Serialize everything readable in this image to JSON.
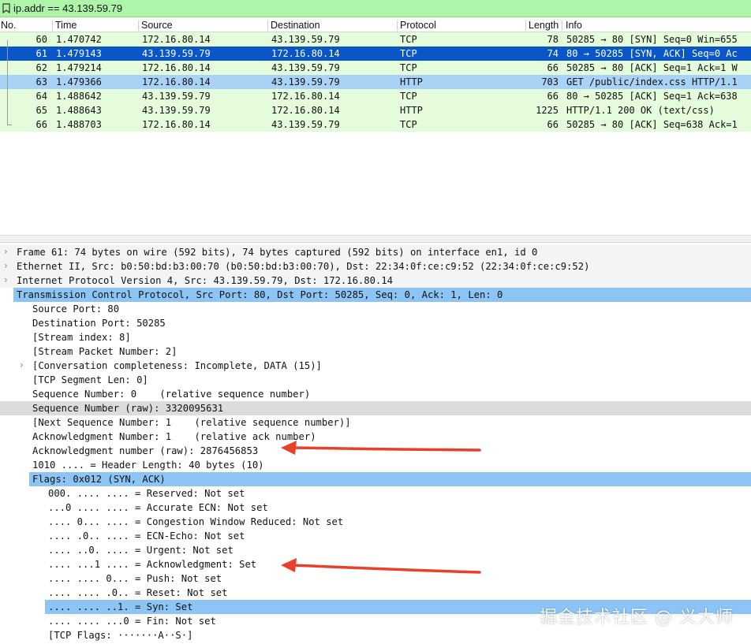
{
  "filter": {
    "value": "ip.addr == 43.139.59.79",
    "icon": "bookmark-icon"
  },
  "packet_list": {
    "columns": [
      "No.",
      "Time",
      "Source",
      "Destination",
      "Protocol",
      "Length",
      "Info"
    ],
    "rows": [
      {
        "no": "60",
        "time": "1.470742",
        "src": "172.16.80.14",
        "dst": "43.139.59.79",
        "proto": "TCP",
        "len": "78",
        "info": "50285 → 80 [SYN] Seq=0 Win=655",
        "bg": "#e4fbdc",
        "fg": "#111111"
      },
      {
        "no": "61",
        "time": "1.479143",
        "src": "43.139.59.79",
        "dst": "172.16.80.14",
        "proto": "TCP",
        "len": "74",
        "info": "80 → 50285 [SYN, ACK] Seq=0 Ac",
        "bg": "#0a55c8",
        "fg": "#ffffff"
      },
      {
        "no": "62",
        "time": "1.479214",
        "src": "172.16.80.14",
        "dst": "43.139.59.79",
        "proto": "TCP",
        "len": "66",
        "info": "50285 → 80 [ACK] Seq=1 Ack=1 W",
        "bg": "#e4fbdc",
        "fg": "#111111"
      },
      {
        "no": "63",
        "time": "1.479366",
        "src": "172.16.80.14",
        "dst": "43.139.59.79",
        "proto": "HTTP",
        "len": "703",
        "info": "GET /public/index.css HTTP/1.1",
        "bg": "#a8d3f7",
        "fg": "#111111"
      },
      {
        "no": "64",
        "time": "1.488642",
        "src": "43.139.59.79",
        "dst": "172.16.80.14",
        "proto": "TCP",
        "len": "66",
        "info": "80 → 50285 [ACK] Seq=1 Ack=638",
        "bg": "#e4fbdc",
        "fg": "#111111"
      },
      {
        "no": "65",
        "time": "1.488643",
        "src": "43.139.59.79",
        "dst": "172.16.80.14",
        "proto": "HTTP",
        "len": "1225",
        "info": "HTTP/1.1 200 OK  (text/css)",
        "bg": "#e4fbdc",
        "fg": "#111111"
      },
      {
        "no": "66",
        "time": "1.488703",
        "src": "172.16.80.14",
        "dst": "43.139.59.79",
        "proto": "TCP",
        "len": "66",
        "info": "50285 → 80 [ACK] Seq=638 Ack=1",
        "bg": "#e4fbdc",
        "fg": "#111111"
      }
    ]
  },
  "details": [
    {
      "text": "Frame 61: 74 bytes on wire (592 bits), 74 bytes captured (592 bits) on interface en1, id 0",
      "indent": 0,
      "chevron": "›",
      "bg": "#f4f4f4",
      "selected": false
    },
    {
      "text": "Ethernet II, Src: b0:50:bd:b3:00:70 (b0:50:bd:b3:00:70), Dst: 22:34:0f:ce:c9:52 (22:34:0f:ce:c9:52)",
      "indent": 0,
      "chevron": "›",
      "bg": "#f4f4f4",
      "selected": false
    },
    {
      "text": "Internet Protocol Version 4, Src: 43.139.59.79, Dst: 172.16.80.14",
      "indent": 0,
      "chevron": "›",
      "bg": "#f4f4f4",
      "selected": false
    },
    {
      "text": "Transmission Control Protocol, Src Port: 80, Dst Port: 50285, Seq: 0, Ack: 1, Len: 0",
      "indent": 0,
      "chevron": "⌄",
      "bg": "#8cc4f5",
      "selected": true
    },
    {
      "text": "Source Port: 80",
      "indent": 1,
      "chevron": "",
      "bg": "",
      "selected": false
    },
    {
      "text": "Destination Port: 50285",
      "indent": 1,
      "chevron": "",
      "bg": "",
      "selected": false
    },
    {
      "text": "[Stream index: 8]",
      "indent": 1,
      "chevron": "",
      "bg": "",
      "selected": false
    },
    {
      "text": "[Stream Packet Number: 2]",
      "indent": 1,
      "chevron": "",
      "bg": "",
      "selected": false
    },
    {
      "text": "[Conversation completeness: Incomplete, DATA (15)]",
      "indent": 1,
      "chevron": "›",
      "bg": "",
      "selected": false
    },
    {
      "text": "[TCP Segment Len: 0]",
      "indent": 1,
      "chevron": "",
      "bg": "",
      "selected": false
    },
    {
      "text": "Sequence Number: 0    (relative sequence number)",
      "indent": 1,
      "chevron": "",
      "bg": "",
      "selected": false
    },
    {
      "text": "Sequence Number (raw): 3320095631",
      "indent": 1,
      "chevron": "",
      "bg": "#dcdcdc",
      "selected": false
    },
    {
      "text": "[Next Sequence Number: 1    (relative sequence number)]",
      "indent": 1,
      "chevron": "",
      "bg": "",
      "selected": false
    },
    {
      "text": "Acknowledgment Number: 1    (relative ack number)",
      "indent": 1,
      "chevron": "",
      "bg": "",
      "selected": false
    },
    {
      "text": "Acknowledgment number (raw): 2876456853",
      "indent": 1,
      "chevron": "",
      "bg": "",
      "selected": false
    },
    {
      "text": "1010 .... = Header Length: 40 bytes (10)",
      "indent": 1,
      "chevron": "",
      "bg": "",
      "selected": false
    },
    {
      "text": "Flags: 0x012 (SYN, ACK)",
      "indent": 1,
      "chevron": "⌄",
      "bg": "#8cc4f5",
      "selected": true
    },
    {
      "text": "000. .... .... = Reserved: Not set",
      "indent": 2,
      "chevron": "",
      "bg": "",
      "selected": false
    },
    {
      "text": "...0 .... .... = Accurate ECN: Not set",
      "indent": 2,
      "chevron": "",
      "bg": "",
      "selected": false
    },
    {
      "text": ".... 0... .... = Congestion Window Reduced: Not set",
      "indent": 2,
      "chevron": "",
      "bg": "",
      "selected": false
    },
    {
      "text": ".... .0.. .... = ECN-Echo: Not set",
      "indent": 2,
      "chevron": "",
      "bg": "",
      "selected": false
    },
    {
      "text": ".... ..0. .... = Urgent: Not set",
      "indent": 2,
      "chevron": "",
      "bg": "",
      "selected": false
    },
    {
      "text": ".... ...1 .... = Acknowledgment: Set",
      "indent": 2,
      "chevron": "",
      "bg": "",
      "selected": false
    },
    {
      "text": ".... .... 0... = Push: Not set",
      "indent": 2,
      "chevron": "",
      "bg": "",
      "selected": false
    },
    {
      "text": ".... .... .0.. = Reset: Not set",
      "indent": 2,
      "chevron": "",
      "bg": "",
      "selected": false
    },
    {
      "text": ".... .... ..1. = Syn: Set",
      "indent": 2,
      "chevron": "›",
      "bg": "#8cc4f5",
      "selected": true
    },
    {
      "text": ".... .... ...0 = Fin: Not set",
      "indent": 2,
      "chevron": "",
      "bg": "",
      "selected": false
    },
    {
      "text": "[TCP Flags: ·······A··S·]",
      "indent": 2,
      "chevron": "",
      "bg": "",
      "selected": false
    }
  ],
  "annotation": {
    "arrow_color": "#e8402a"
  },
  "watermark": "掘金技术社区 @ 义大师"
}
